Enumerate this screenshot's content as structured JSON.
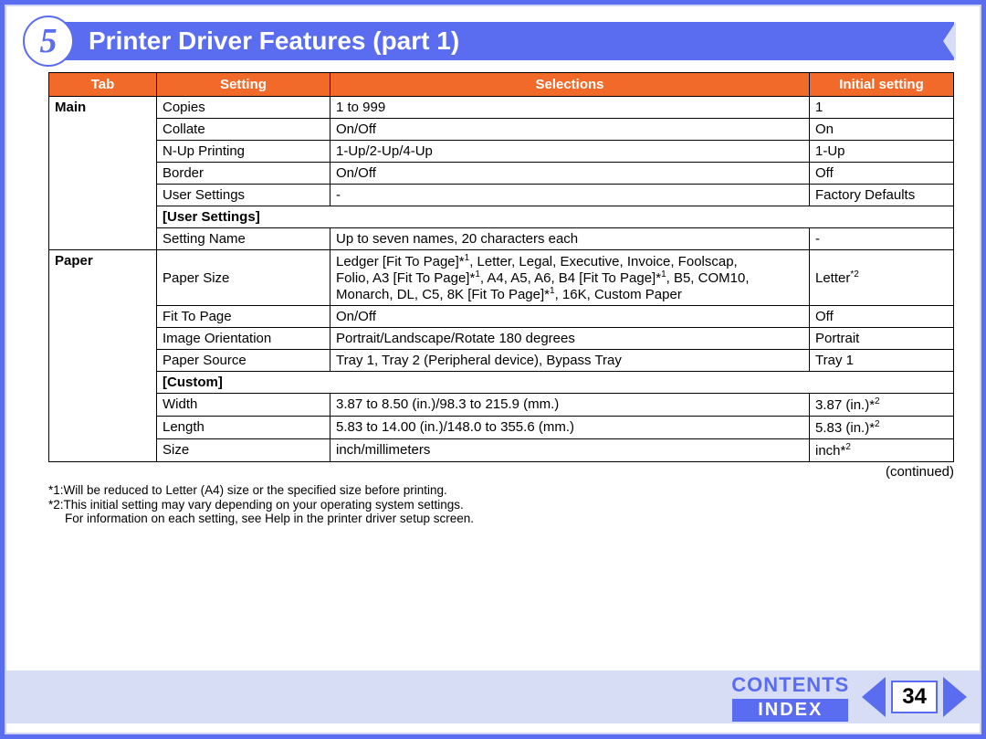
{
  "chapter_number": "5",
  "page_title": "Printer Driver Features (part 1)",
  "table": {
    "headers": {
      "tab": "Tab",
      "setting": "Setting",
      "selections": "Selections",
      "initial": "Initial setting"
    },
    "main_label": "Main",
    "main_rows": [
      {
        "setting": "Copies",
        "selections": "1 to 999",
        "initial": "1"
      },
      {
        "setting": "Collate",
        "selections": "On/Off",
        "initial": "On"
      },
      {
        "setting": "N-Up Printing",
        "selections": "1-Up/2-Up/4-Up",
        "initial": "1-Up"
      },
      {
        "setting": "Border",
        "selections": "On/Off",
        "initial": "Off"
      },
      {
        "setting": "User Settings",
        "selections": "-",
        "initial": "Factory Defaults"
      }
    ],
    "user_settings_label": "[User Settings]",
    "user_settings_row": {
      "setting": "Setting Name",
      "selections": "Up to seven names, 20 characters each",
      "initial": "-"
    },
    "paper_label": "Paper",
    "paper_size_setting": "Paper Size",
    "paper_size_sel_line1": "Ledger [Fit To Page]*",
    "paper_size_sel_line1b": ", Letter, Legal, Executive, Invoice, Foolscap,",
    "paper_size_sel_line2a": "Folio, A3 [Fit To Page]*",
    "paper_size_sel_line2b": ", A4, A5, A6, B4 [Fit To Page]*",
    "paper_size_sel_line2c": ", B5, COM10,",
    "paper_size_sel_line3a": "Monarch, DL, C5, 8K [Fit To Page]*",
    "paper_size_sel_line3b": ", 16K, Custom Paper",
    "paper_size_initial": "Letter",
    "paper_rows2": [
      {
        "setting": "Fit To Page",
        "selections": "On/Off",
        "initial": "Off"
      },
      {
        "setting": "Image Orientation",
        "selections": "Portrait/Landscape/Rotate 180 degrees",
        "initial": "Portrait"
      },
      {
        "setting": "Paper Source",
        "selections": "Tray 1, Tray 2 (Peripheral device), Bypass Tray",
        "initial": "Tray 1"
      }
    ],
    "custom_label": "[Custom]",
    "custom_rows": [
      {
        "setting": "Width",
        "selections": "3.87 to 8.50 (in.)/98.3 to 215.9 (mm.)",
        "initial": "3.87 (in.)*"
      },
      {
        "setting": "Length",
        "selections": "5.83 to 14.00 (in.)/148.0 to 355.6 (mm.)",
        "initial": "5.83 (in.)*"
      },
      {
        "setting": "Size",
        "selections": "inch/millimeters",
        "initial": "inch*"
      }
    ]
  },
  "continued": "(continued)",
  "footnotes": {
    "f1": "*1:Will be reduced to Letter (A4) size or the specified size before printing.",
    "f2": "*2:This initial setting may vary depending on your operating system settings.",
    "f3": "For information on each setting, see Help in the printer driver setup screen."
  },
  "footer": {
    "contents": "CONTENTS",
    "index": "INDEX",
    "page": "34"
  },
  "sup1": "1",
  "sup2": "2",
  "sup_star2": "*2"
}
